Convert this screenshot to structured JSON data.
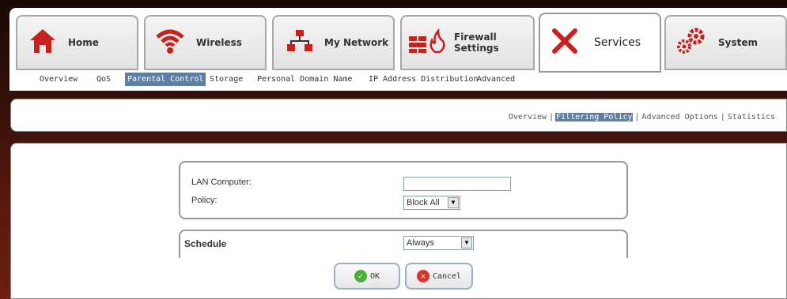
{
  "tabs": [
    {
      "label": "Home",
      "icon": "home-icon"
    },
    {
      "label": "Wireless",
      "icon": "wifi-icon"
    },
    {
      "label": "My Network",
      "icon": "network-icon"
    },
    {
      "label": "Firewall Settings",
      "icon": "firewall-icon"
    },
    {
      "label": "Services",
      "icon": "tools-icon",
      "active": true
    },
    {
      "label": "System",
      "icon": "gears-icon"
    }
  ],
  "subnav": {
    "items": [
      "Overview",
      "QoS",
      "Parental Control",
      "Storage",
      "Personal Domain Name",
      "IP Address Distribution",
      "Advanced"
    ],
    "active": "Parental Control"
  },
  "subtabs": {
    "items": [
      "Overview",
      "Filtering Policy",
      "Advanced Options",
      "Statistics"
    ],
    "active": "Filtering Policy"
  },
  "form": {
    "lan_computer_label": "LAN Computer:",
    "lan_computer_value": "",
    "policy_label": "Policy:",
    "policy_value": "Block All",
    "schedule_label": "Schedule",
    "schedule_value": "Always"
  },
  "buttons": {
    "ok_label": "OK",
    "cancel_label": "Cancel"
  },
  "colors": {
    "active_highlight": "#5d7ea6",
    "icon_red": "#c8201a",
    "ok_green": "#4caf3a",
    "cancel_red": "#d9362b"
  }
}
